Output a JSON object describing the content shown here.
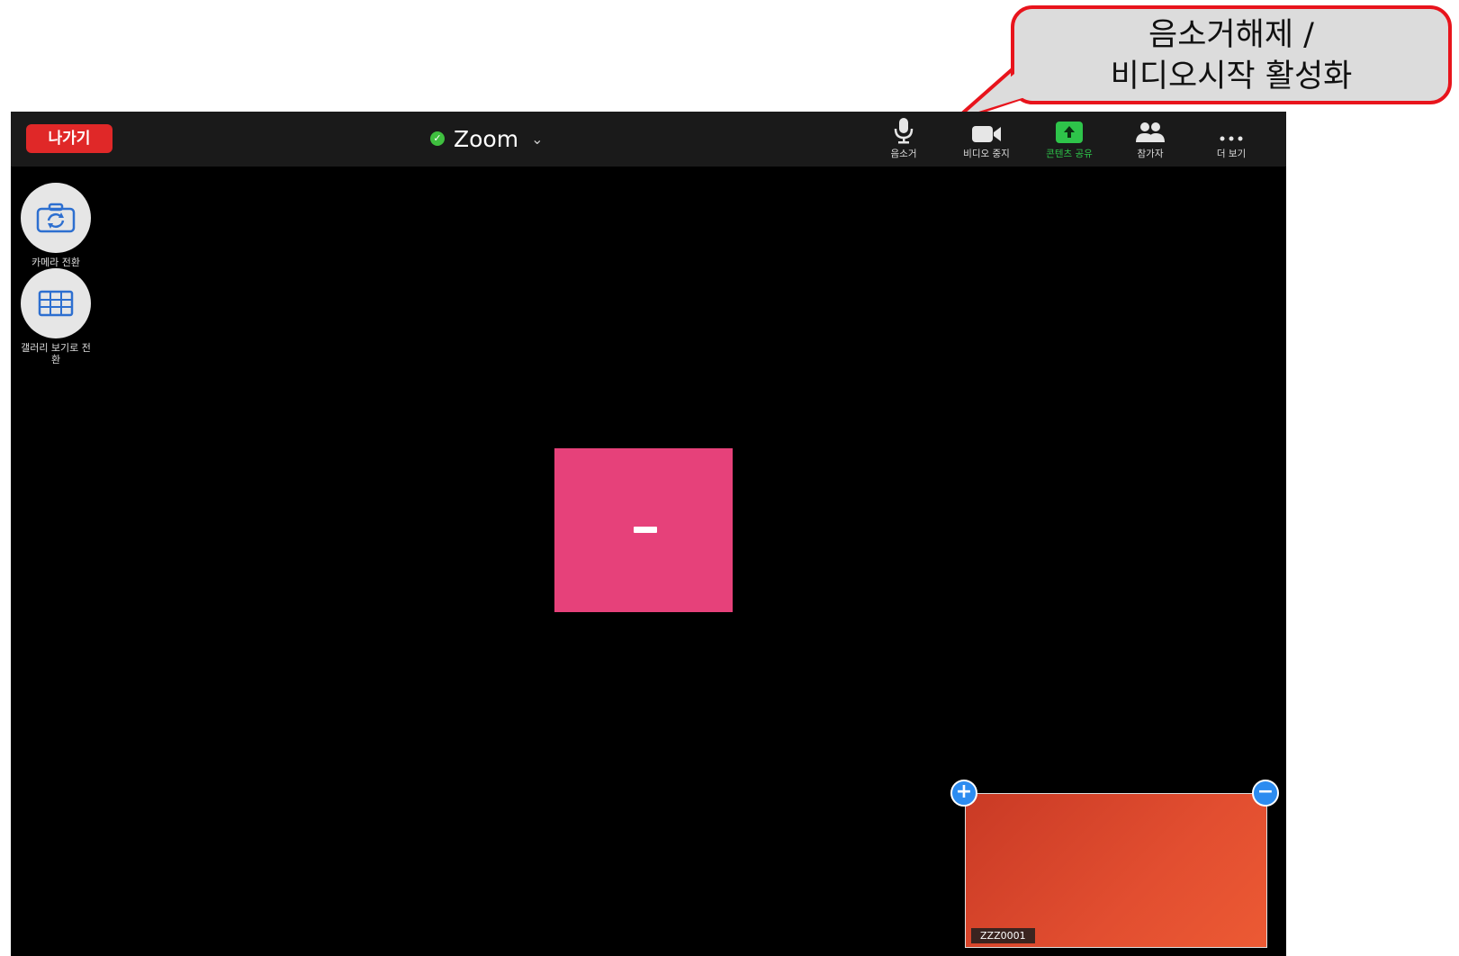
{
  "callout": {
    "line1": "음소거해제 /",
    "line2": "비디오시작 활성화",
    "border_color": "#e8141c"
  },
  "topbar": {
    "leave_label": "나가기",
    "title": "Zoom",
    "shield_icon": "shield-check-icon",
    "tools": [
      {
        "label": "음소거",
        "icon": "microphone-icon"
      },
      {
        "label": "비디오 중지",
        "icon": "video-camera-icon"
      },
      {
        "label": "콘텐츠 공유",
        "icon": "share-screen-icon"
      },
      {
        "label": "참가자",
        "icon": "participants-icon"
      },
      {
        "label": "더 보기",
        "icon": "more-icon"
      }
    ]
  },
  "side": {
    "camera_switch_label": "카메라 전환",
    "gallery_view_label": "갤러리 보기로 전환"
  },
  "self_view": {
    "name": "ZZZ0001"
  },
  "colors": {
    "avatar": "#e6417a",
    "leave_button": "#e02828",
    "share_green": "#2ec44a",
    "control_blue": "#2d8cf0"
  }
}
